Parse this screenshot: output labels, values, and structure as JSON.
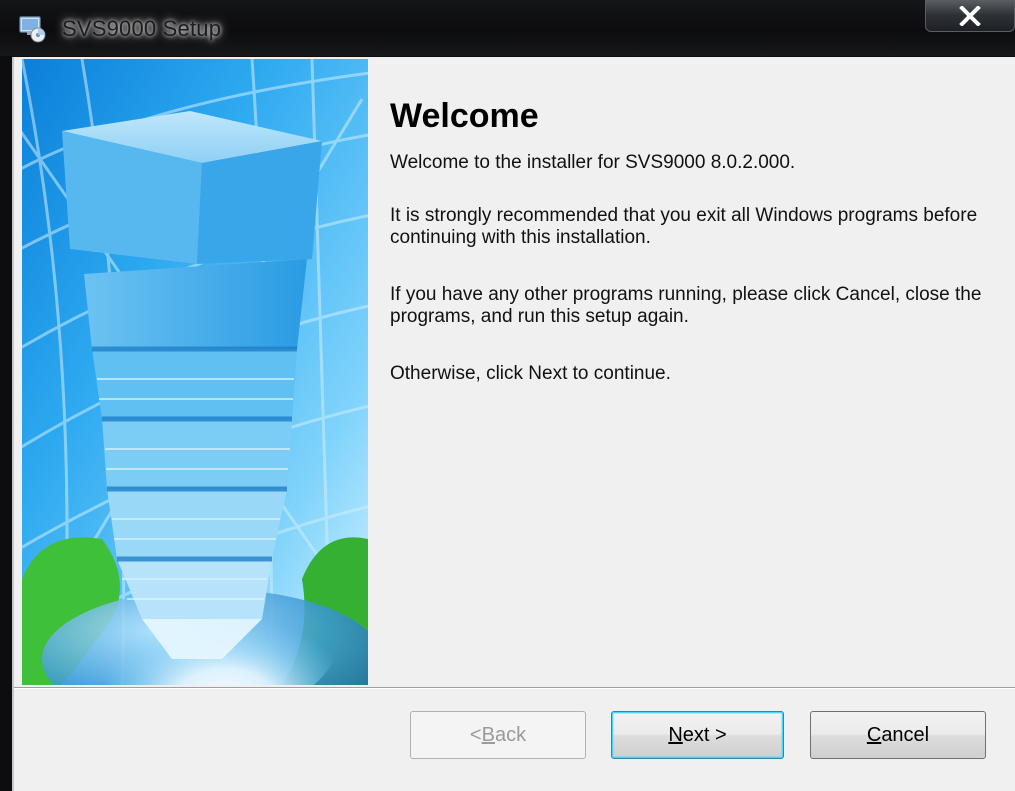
{
  "window": {
    "title": "SVS9000 Setup",
    "close_label": "X"
  },
  "content": {
    "heading": "Welcome",
    "intro": "Welcome to the installer for SVS9000 8.0.2.000.",
    "recommendation": "It is strongly recommended that you exit all Windows programs before continuing with this installation.",
    "running_programs": "If you have any other programs running, please click Cancel, close the programs, and run this setup again.",
    "continue_hint": "Otherwise, click Next to continue."
  },
  "buttons": {
    "back": {
      "prefix": "< ",
      "mnemonic": "B",
      "rest": "ack",
      "enabled": false
    },
    "next": {
      "mnemonic": "N",
      "rest": "ext >",
      "default": true
    },
    "cancel": {
      "mnemonic": "C",
      "rest": "ancel"
    }
  },
  "colors": {
    "client_bg": "#f0f0f0",
    "titlebar_bg": "#0d0d0f",
    "default_button_border": "#3c7fb1"
  },
  "icons": [
    "installer-app-icon",
    "close-icon",
    "tower-globe-banner"
  ]
}
